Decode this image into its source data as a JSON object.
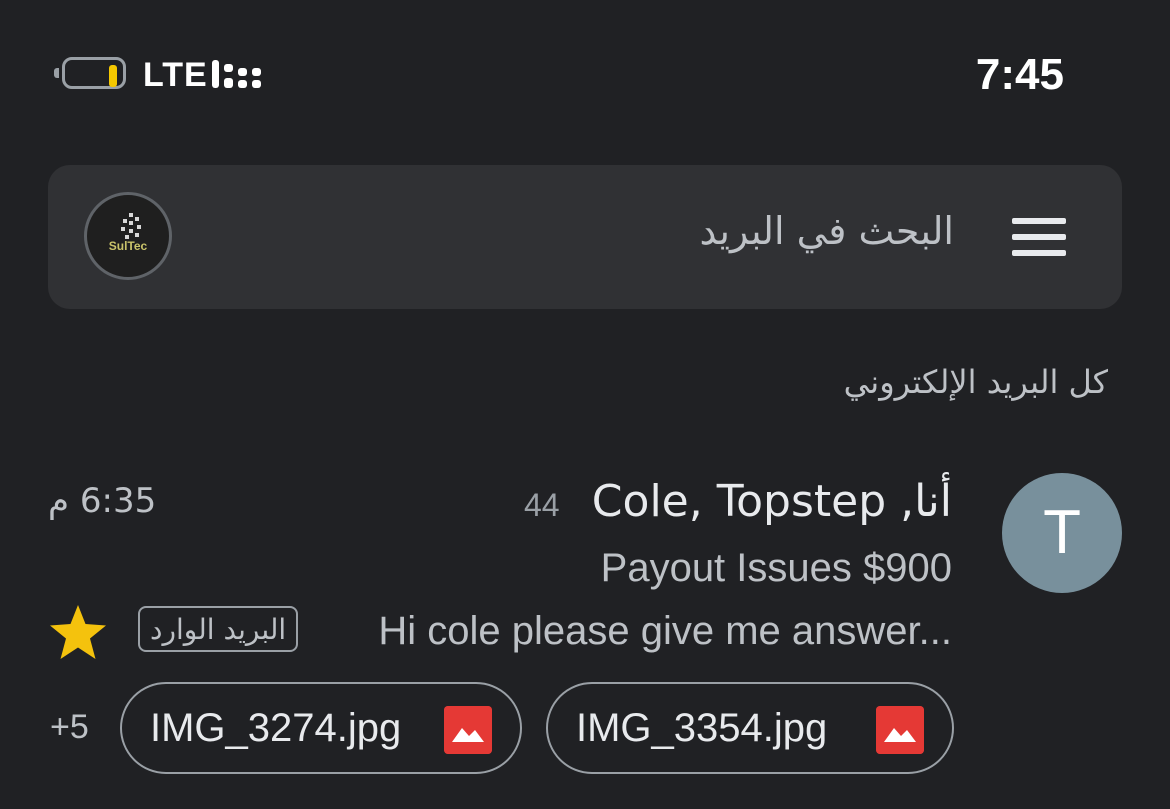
{
  "status_bar": {
    "network": "LTE",
    "time": "7:45",
    "battery_level": 0.1,
    "battery_color": "#f5c800"
  },
  "search": {
    "placeholder": "البحث في البريد",
    "account_brand": "SulTec",
    "menu_icon": "hamburger-menu-icon",
    "account_icon": "account-avatar-icon"
  },
  "mailbox": {
    "label": "كل البريد الإلكتروني"
  },
  "emails": [
    {
      "avatar_letter": "T",
      "avatar_color": "#78909c",
      "senders": "أنا, Cole, Topstep",
      "count": "44",
      "time": "6:35 م",
      "subject": "Payout Issues $900",
      "snippet": "Hi cole please give me answer...",
      "label": "البريد الوارد",
      "starred": true,
      "attachments": [
        {
          "name": "IMG_3354.jpg",
          "icon": "image-icon"
        },
        {
          "name": "IMG_3274.jpg",
          "icon": "image-icon"
        }
      ],
      "more_attachments": "+5"
    }
  ]
}
